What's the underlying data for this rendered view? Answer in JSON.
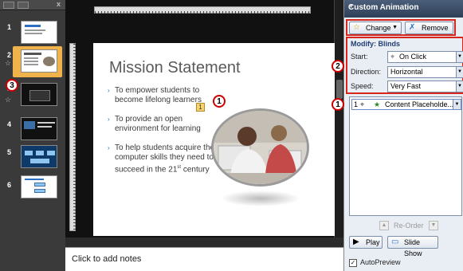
{
  "sidebar": {
    "close_label": "x",
    "slides": [
      {
        "number": "1",
        "variant": "light",
        "star": ""
      },
      {
        "number": "2",
        "variant": "light",
        "star": "☆",
        "selected": true
      },
      {
        "number": "3",
        "variant": "dark",
        "star": "☆"
      },
      {
        "number": "4",
        "variant": "dark",
        "star": ""
      },
      {
        "number": "5",
        "variant": "blue",
        "star": ""
      },
      {
        "number": "6",
        "variant": "light",
        "star": ""
      }
    ]
  },
  "slide": {
    "title": "Mission Statement",
    "bullets": [
      {
        "text": "To empower students to become lifelong learners"
      },
      {
        "text": "To provide an open environment for learning"
      },
      {
        "text_before": "To help students acquire the computer skills they need to succeed in the 21",
        "sup": "st",
        "text_after": " century"
      }
    ],
    "animation_tag": "1",
    "bullet_mark": "›"
  },
  "notes": {
    "placeholder": "Click to add notes"
  },
  "pane": {
    "title": "Custom Animation",
    "change_label": "Change",
    "change_arrow": "▼",
    "remove_label": "Remove",
    "modify_title": "Modify: Blinds",
    "start_label": "Start:",
    "start_value": "On Click",
    "direction_label": "Direction:",
    "direction_value": "Horizontal",
    "speed_label": "Speed:",
    "speed_value": "Very Fast",
    "list_item": {
      "number": "1",
      "text": "Content Placeholde..."
    },
    "reorder_label": "Re-Order",
    "play_label": "Play",
    "slideshow_label": "Slide Show",
    "autopreview_label": "AutoPreview",
    "autopreview_checked": true
  },
  "callouts": {
    "one": "1",
    "two": "2",
    "three": "3"
  },
  "colors": {
    "accent_highlight": "#d9261c",
    "selected_thumb": "#f0b24b",
    "pane_header": "#2f3f58"
  }
}
